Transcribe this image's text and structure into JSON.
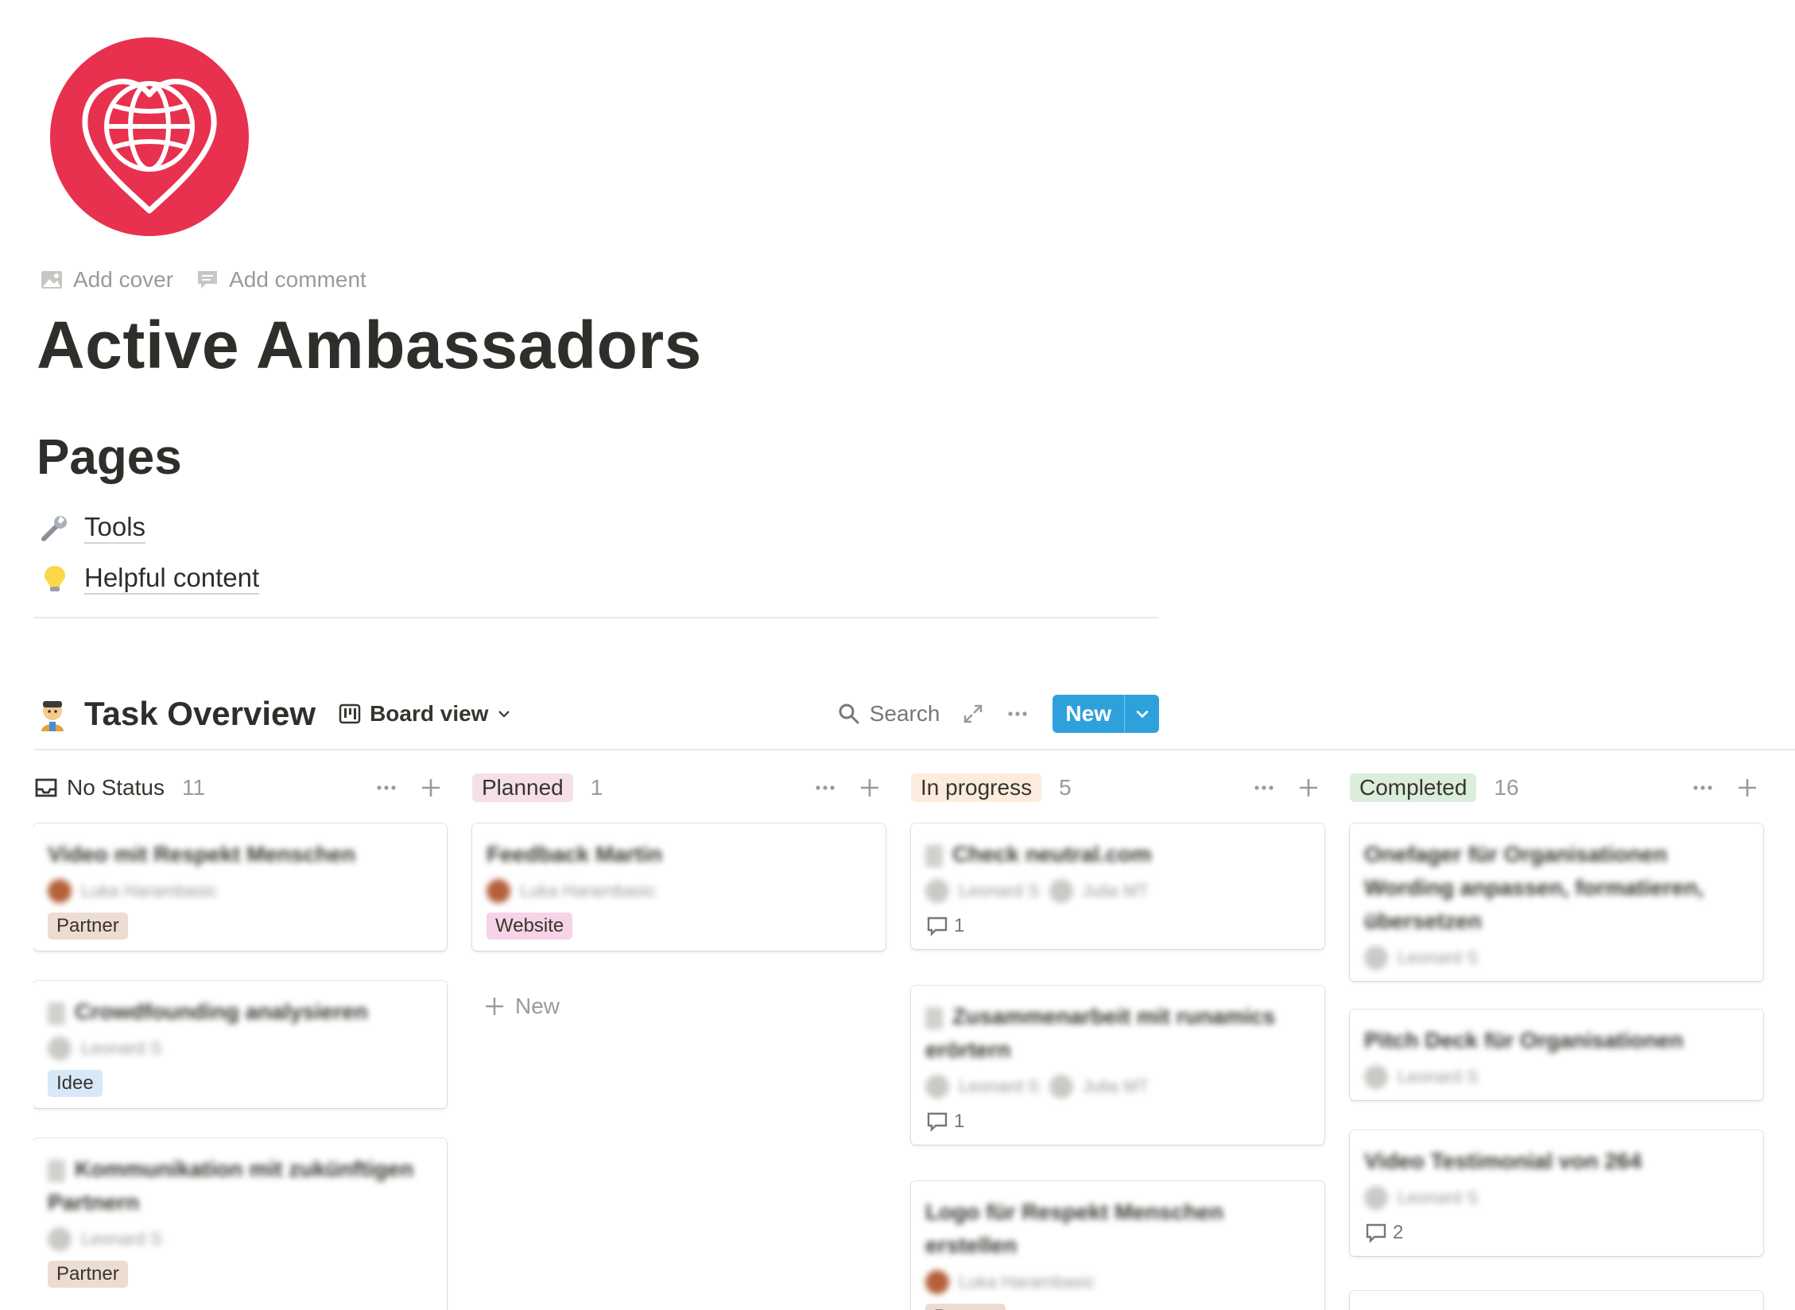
{
  "page": {
    "icon": "globe-heart-icon",
    "add_cover": "Add cover",
    "add_comment": "Add comment",
    "title": "Active Ambassadors"
  },
  "pages_section": {
    "heading": "Pages",
    "links": [
      {
        "icon": "wrench-icon",
        "label": "Tools"
      },
      {
        "icon": "lightbulb-icon",
        "label": "Helpful content"
      }
    ]
  },
  "database": {
    "icon": "ninja-emoji-icon",
    "title": "Task Overview",
    "view": "Board view",
    "search": "Search",
    "new_button": "New",
    "add_new": "New"
  },
  "columns": [
    {
      "name": "No Status",
      "count": "11",
      "tag_color": "",
      "icon": "inbox-icon"
    },
    {
      "name": "Planned",
      "count": "1",
      "tag_color": "#f5e0e9"
    },
    {
      "name": "In progress",
      "count": "5",
      "tag_color": "#fbecdd"
    },
    {
      "name": "Completed",
      "count": "16",
      "tag_color": "#dbeddb"
    }
  ],
  "cards": {
    "no_status": [
      {
        "title": "Video mit Respekt Menschen",
        "person": "Luka Harambasic",
        "tag": "Partner"
      },
      {
        "title": "Crowdfounding analysieren",
        "person": "Leonard S",
        "tag": "Idee"
      },
      {
        "title": "Kommunikation mit zukünftigen Partnern",
        "person": "Leonard S",
        "tag": "Partner"
      }
    ],
    "planned": [
      {
        "title": "Feedback Martin",
        "person": "Luka Harambasic",
        "tag": "Website"
      }
    ],
    "in_progress": [
      {
        "title": "Check neutral.com",
        "person": "Leonard S",
        "person2": "Julia MT",
        "comments": "1"
      },
      {
        "title": "Zusammenarbeit mit runamics erörtern",
        "person": "Leonard S",
        "person2": "Julia MT",
        "comments": "1"
      },
      {
        "title": "Logo für Respekt Menschen erstellen",
        "person": "Luka Harambasic",
        "tag": "Partner"
      }
    ],
    "completed": [
      {
        "title": "Onefager für Organisationen Wording anpassen, formatieren, übersetzen",
        "person": "Leonard S"
      },
      {
        "title": "Pitch Deck für Organisationen",
        "person": "Leonard S"
      },
      {
        "title": "Video Testimonial von 264",
        "person": "Leonard S",
        "comments": "2"
      }
    ]
  },
  "colors": {
    "icon_bg": "#e8314f",
    "new_button": "#2ea1dd"
  }
}
